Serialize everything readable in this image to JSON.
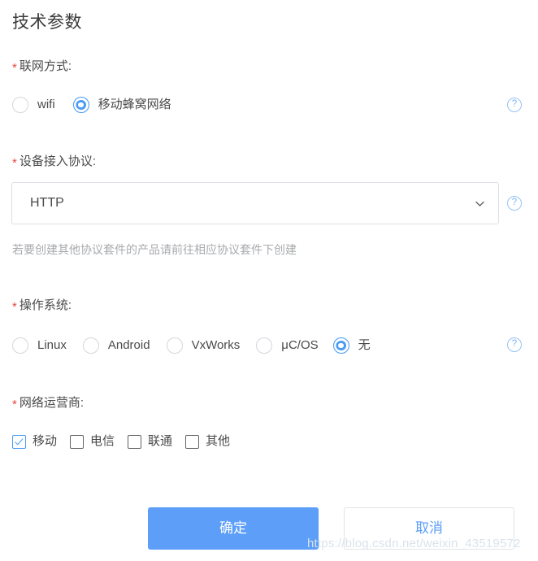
{
  "page": {
    "title": "技术参数",
    "required_marker": "*"
  },
  "fields": {
    "network_mode": {
      "label": "联网方式:",
      "type": "radio",
      "options": [
        {
          "label": "wifi",
          "checked": false
        },
        {
          "label": "移动蜂窝网络",
          "checked": true
        }
      ],
      "help_icon": "question-mark-icon",
      "help_glyph": "?"
    },
    "access_protocol": {
      "label": "设备接入协议:",
      "type": "select",
      "value": "HTTP",
      "placeholder": "请选择",
      "chevron_icon": "chevron-down-icon",
      "hint": "若要创建其他协议套件的产品请前往相应协议套件下创建",
      "help_icon": "question-mark-icon",
      "help_glyph": "?"
    },
    "operating_system": {
      "label": "操作系统:",
      "type": "radio",
      "options": [
        {
          "label": "Linux",
          "checked": false
        },
        {
          "label": "Android",
          "checked": false
        },
        {
          "label": "VxWorks",
          "checked": false
        },
        {
          "label": "μC/OS",
          "checked": false
        },
        {
          "label": "无",
          "checked": true
        }
      ],
      "help_icon": "question-mark-icon",
      "help_glyph": "?"
    },
    "network_operator": {
      "label": "网络运营商:",
      "type": "checkbox",
      "options": [
        {
          "label": "移动",
          "checked": true
        },
        {
          "label": "电信",
          "checked": false
        },
        {
          "label": "联通",
          "checked": false
        },
        {
          "label": "其他",
          "checked": false
        }
      ]
    }
  },
  "footer": {
    "confirm_label": "确定",
    "cancel_label": "取消"
  },
  "watermark": {
    "text": "https://blog.csdn.net/weixin_43519572"
  },
  "colors": {
    "accent": "#4b9bf5",
    "primary_button": "#5c9ef8",
    "required_star": "#e8453c",
    "label_text": "#4a4a4a",
    "hint_text": "#a8aaad",
    "border": "#dcdfe6",
    "help_icon": "#7fb4f2",
    "watermark": "#d9e3ec"
  }
}
